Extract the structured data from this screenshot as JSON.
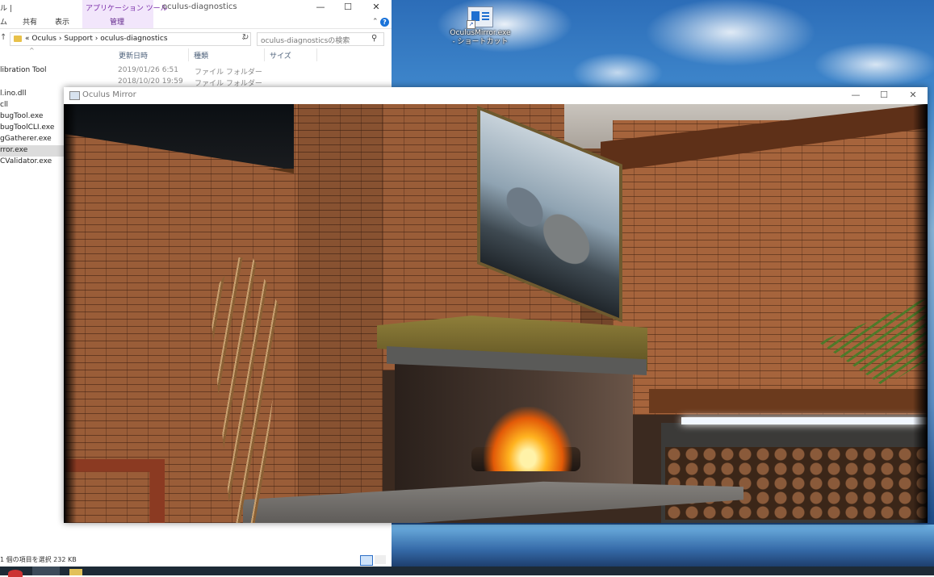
{
  "explorer": {
    "title": "oculus-diagnostics",
    "titlebar_left": "ル |",
    "ribbon": {
      "tabs": [
        "共有",
        "表示"
      ],
      "left_tab_fragment": "ム",
      "context_group": "アプリケーション ツール",
      "context_tab": "管理"
    },
    "window_controls": {
      "minimize": "—",
      "maximize": "☐",
      "close": "✕"
    },
    "address": {
      "path": "« Oculus  ›  Support  ›  oculus-diagnostics",
      "search_placeholder": "oculus-diagnosticsの検索"
    },
    "columns": [
      "更新日時",
      "種類",
      "サイズ"
    ],
    "files": [
      {
        "name": "libration Tool",
        "date": "2019/01/26 6:51",
        "type": "ファイル フォルダー"
      },
      {
        "name": "",
        "date": "2018/10/20 19:59",
        "type": "ファイル フォルダー"
      },
      {
        "name": "l.ino.dll",
        "date": "",
        "type": ""
      },
      {
        "name": "cll",
        "date": "",
        "type": ""
      },
      {
        "name": "bugTool.exe",
        "date": "",
        "type": ""
      },
      {
        "name": "bugToolCLI.exe",
        "date": "",
        "type": ""
      },
      {
        "name": "gGatherer.exe",
        "date": "",
        "type": ""
      },
      {
        "name": "rror.exe",
        "date": "",
        "type": ""
      },
      {
        "name": "CValidator.exe",
        "date": "",
        "type": ""
      }
    ],
    "status": "1 個の項目を選択  232 KB"
  },
  "desktop": {
    "shortcut_label": "OculusMirror.exe - ショートカット"
  },
  "mirror": {
    "title": "Oculus Mirror",
    "window_controls": {
      "minimize": "—",
      "maximize": "☐",
      "close": "✕"
    }
  },
  "icons": [
    "folder-icon",
    "search-icon",
    "refresh-icon",
    "help-icon",
    "shortcut-arrow-icon",
    "app-icon"
  ]
}
